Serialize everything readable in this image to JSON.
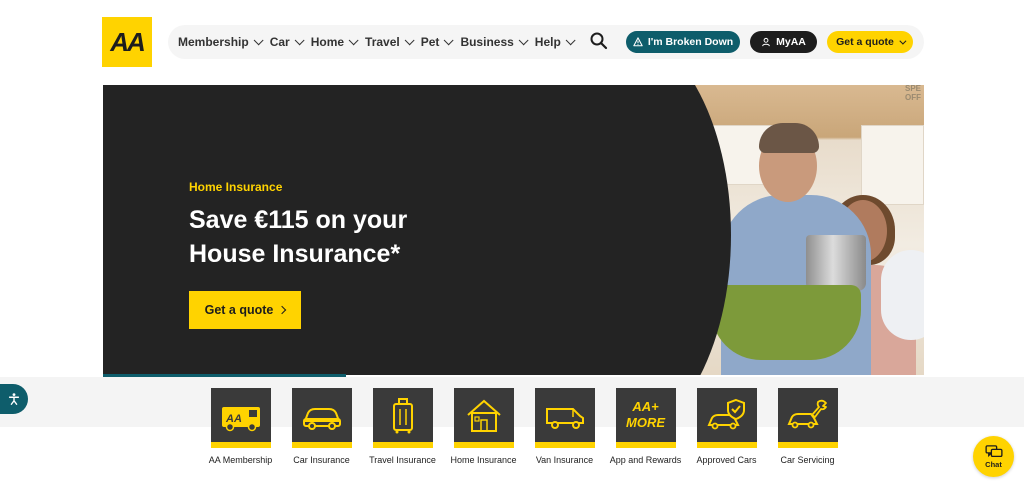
{
  "brand": {
    "logo_text": "AA",
    "accent": "#ffd300",
    "teal": "#0e5d6b",
    "dark": "#232323"
  },
  "nav": {
    "items": [
      {
        "label": "Membership"
      },
      {
        "label": "Car"
      },
      {
        "label": "Home"
      },
      {
        "label": "Travel"
      },
      {
        "label": "Pet"
      },
      {
        "label": "Business"
      },
      {
        "label": "Help"
      }
    ],
    "search_icon": "search-icon",
    "broken_down_label": "I'm Broken Down",
    "myaa_label": "MyAA",
    "quote_label": "Get a quote"
  },
  "hero": {
    "eyebrow": "Home Insurance",
    "title": "Save €115 on your House Insurance*",
    "cta_label": "Get a quote",
    "corner_text_1": "SPE",
    "corner_text_2": "OFF"
  },
  "products": [
    {
      "label": "AA Membership",
      "icon": "van-icon"
    },
    {
      "label": "Car Insurance",
      "icon": "car-icon"
    },
    {
      "label": "Travel Insurance",
      "icon": "suitcase-icon"
    },
    {
      "label": "Home Insurance",
      "icon": "house-icon"
    },
    {
      "label": "Van Insurance",
      "icon": "van-icon"
    },
    {
      "label": "App and Rewards",
      "icon": "aa-more-icon",
      "badge_line1": "AA+",
      "badge_line2": "MORE"
    },
    {
      "label": "Approved Cars",
      "icon": "car-shield-icon"
    },
    {
      "label": "Car Servicing",
      "icon": "car-wrench-icon"
    }
  ],
  "chat": {
    "label": "Chat"
  }
}
